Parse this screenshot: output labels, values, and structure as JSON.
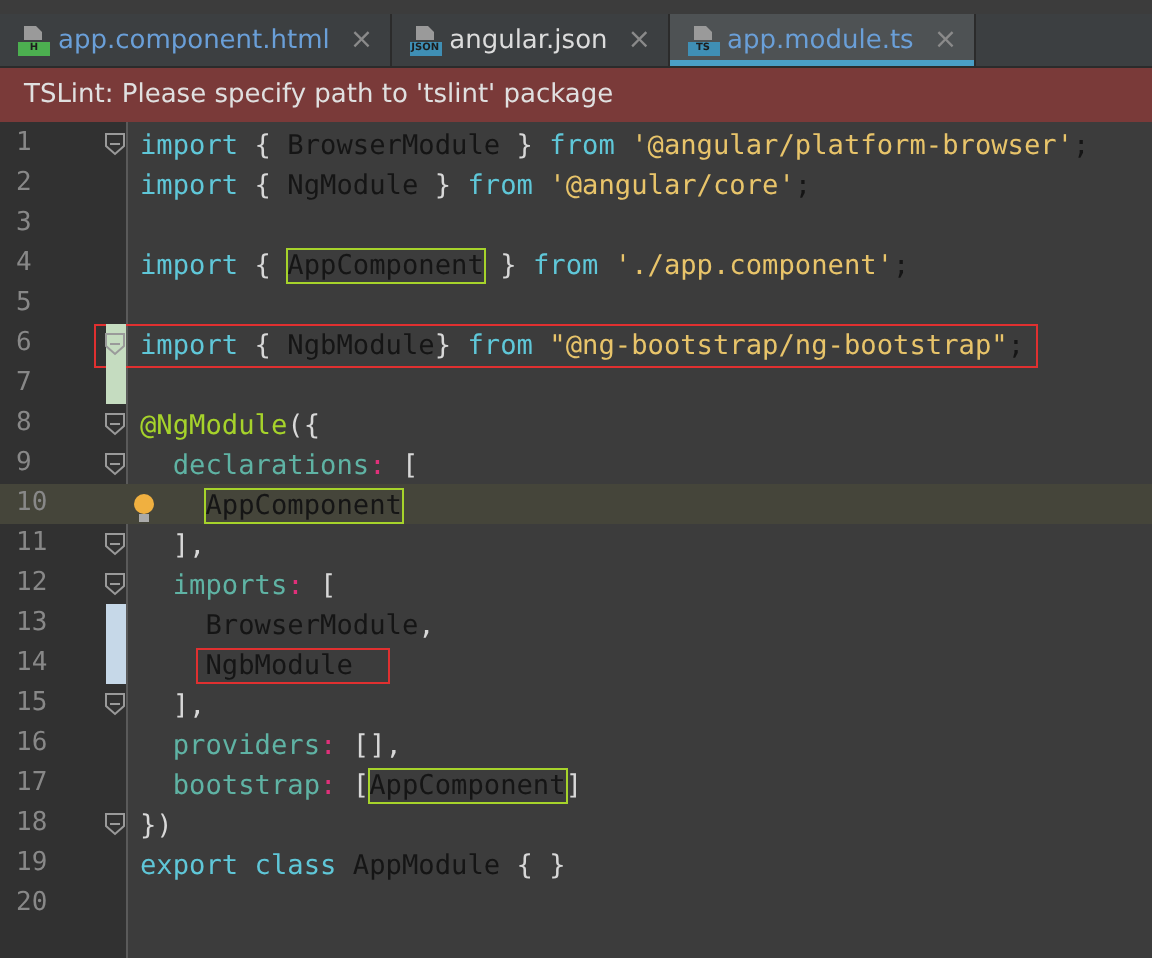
{
  "tabs": [
    {
      "label": "app.component.html",
      "file_type": "H",
      "color": "#6a9fd8",
      "close": "×",
      "selected": false
    },
    {
      "label": "angular.json",
      "file_type": "JSON",
      "color": "#dcdcdc",
      "close": "×",
      "selected": false
    },
    {
      "label": "app.module.ts",
      "file_type": "TS",
      "color": "#6a9fd8",
      "close": "×",
      "selected": true
    }
  ],
  "error_banner": "TSLint: Please specify path to 'tslint' package",
  "lines": [
    {
      "number": "1",
      "fold": true,
      "tokens": [
        {
          "kind": "kw",
          "text": "import"
        },
        {
          "kind": "punct",
          "text": " { "
        },
        {
          "kind": "id",
          "text": "BrowserModule"
        },
        {
          "kind": "punct",
          "text": " } "
        },
        {
          "kind": "kw",
          "text": "from"
        },
        {
          "kind": "str",
          "text": " '@angular/platform-browser'"
        },
        {
          "kind": "id",
          "text": ";"
        }
      ]
    },
    {
      "number": "2",
      "fold": false,
      "tokens": [
        {
          "kind": "kw",
          "text": "import"
        },
        {
          "kind": "punct",
          "text": " { "
        },
        {
          "kind": "id",
          "text": "NgModule"
        },
        {
          "kind": "punct",
          "text": " } "
        },
        {
          "kind": "kw",
          "text": "from"
        },
        {
          "kind": "str",
          "text": " '@angular/core'"
        },
        {
          "kind": "id",
          "text": ";"
        }
      ]
    },
    {
      "number": "3",
      "fold": false
    },
    {
      "number": "4",
      "fold": false,
      "tokens": [
        {
          "kind": "kw",
          "text": "import"
        },
        {
          "kind": "punct",
          "text": " { "
        },
        {
          "kind": "id",
          "text": "AppComponent",
          "highlighted": true
        },
        {
          "kind": "punct",
          "text": " } "
        },
        {
          "kind": "kw",
          "text": "from"
        },
        {
          "kind": "str",
          "text": " './app.component'"
        },
        {
          "kind": "id",
          "text": ";"
        }
      ]
    },
    {
      "number": "5",
      "fold": false
    },
    {
      "number": "6",
      "fold": true,
      "added": true,
      "boxed": true,
      "tokens": [
        {
          "kind": "kw",
          "text": "import"
        },
        {
          "kind": "punct",
          "text": " { "
        },
        {
          "kind": "id",
          "text": "NgbModule"
        },
        {
          "kind": "punct",
          "text": "} "
        },
        {
          "kind": "kw",
          "text": "from"
        },
        {
          "kind": "str",
          "text": " \"@ng-bootstrap/ng-bootstrap\""
        },
        {
          "kind": "id",
          "text": ";"
        }
      ]
    },
    {
      "number": "7",
      "fold": false,
      "added": true
    },
    {
      "number": "8",
      "fold": true,
      "tokens": [
        {
          "kind": "deco",
          "text": "@NgModule"
        },
        {
          "kind": "punct",
          "text": "({"
        }
      ]
    },
    {
      "number": "9",
      "fold": true,
      "tokens": [
        {
          "kind": "prop",
          "text": "  declarations"
        },
        {
          "kind": "colon",
          "text": ":"
        },
        {
          "kind": "punct",
          "text": " ["
        }
      ]
    },
    {
      "number": "10",
      "fold": false,
      "current": true,
      "hint": true,
      "tokens": [
        {
          "kind": "id",
          "text": "AppComponent",
          "highlighted": true,
          "indented": true
        }
      ]
    },
    {
      "number": "11",
      "fold": true,
      "tokens": [
        {
          "kind": "punct",
          "text": "  ],"
        }
      ]
    },
    {
      "number": "12",
      "fold": true,
      "tokens": [
        {
          "kind": "prop",
          "text": "  imports"
        },
        {
          "kind": "colon",
          "text": ":"
        },
        {
          "kind": "punct",
          "text": " ["
        }
      ]
    },
    {
      "number": "13",
      "fold": false,
      "modified": true,
      "tokens": [
        {
          "kind": "id",
          "text": "    BrowserModule"
        },
        {
          "kind": "punct",
          "text": ","
        }
      ]
    },
    {
      "number": "14",
      "fold": false,
      "modified": true,
      "tokens": [
        {
          "kind": "id",
          "text": "NgbModule",
          "boxed": true,
          "indented": true
        }
      ]
    },
    {
      "number": "15",
      "fold": true,
      "tokens": [
        {
          "kind": "punct",
          "text": "  ],"
        }
      ]
    },
    {
      "number": "16",
      "fold": false,
      "tokens": [
        {
          "kind": "prop",
          "text": "  providers"
        },
        {
          "kind": "colon",
          "text": ":"
        },
        {
          "kind": "punct",
          "text": " [],"
        }
      ]
    },
    {
      "number": "17",
      "fold": false,
      "tokens": [
        {
          "kind": "prop",
          "text": "  bootstrap"
        },
        {
          "kind": "colon",
          "text": ":"
        },
        {
          "kind": "punct",
          "text": " ["
        },
        {
          "kind": "id",
          "text": "AppComponent",
          "highlighted": true
        },
        {
          "kind": "punct",
          "text": "]"
        }
      ]
    },
    {
      "number": "18",
      "fold": true,
      "tokens": [
        {
          "kind": "punct",
          "text": "})"
        }
      ]
    },
    {
      "number": "19",
      "fold": false,
      "tokens": [
        {
          "kind": "kw",
          "text": "export class "
        },
        {
          "kind": "id",
          "text": "AppModule"
        },
        {
          "kind": "punct",
          "text": " { }"
        }
      ]
    },
    {
      "number": "20",
      "fold": false
    }
  ]
}
